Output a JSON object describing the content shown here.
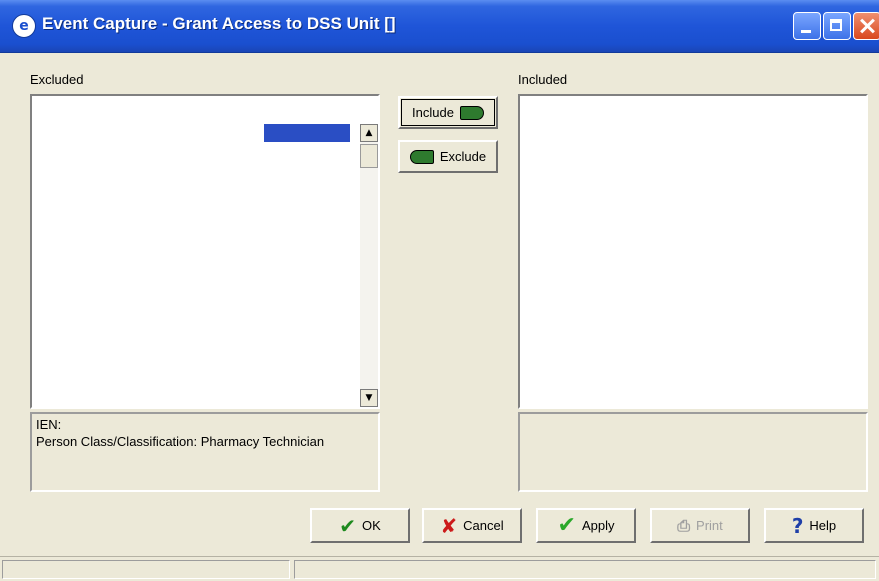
{
  "window": {
    "title": "Event Capture - Grant Access to DSS Unit []",
    "icon": "event-capture-app-icon"
  },
  "excluded": {
    "label": "Excluded",
    "underline_char": "x"
  },
  "included": {
    "label": "Included",
    "underline_char": "I"
  },
  "transfer_buttons": {
    "include": "Include",
    "exclude": "Exclude"
  },
  "info": {
    "ien_label": "IEN:",
    "person_class": "Person Class/Classification: Pharmacy Technician"
  },
  "footer_buttons": {
    "ok": "OK",
    "cancel": "Cancel",
    "apply": "Apply",
    "print": "Print",
    "help": "Help"
  },
  "colors": {
    "titlebar": "#1f55d8",
    "selection": "#2a4ec4",
    "face": "#ece9d8"
  }
}
